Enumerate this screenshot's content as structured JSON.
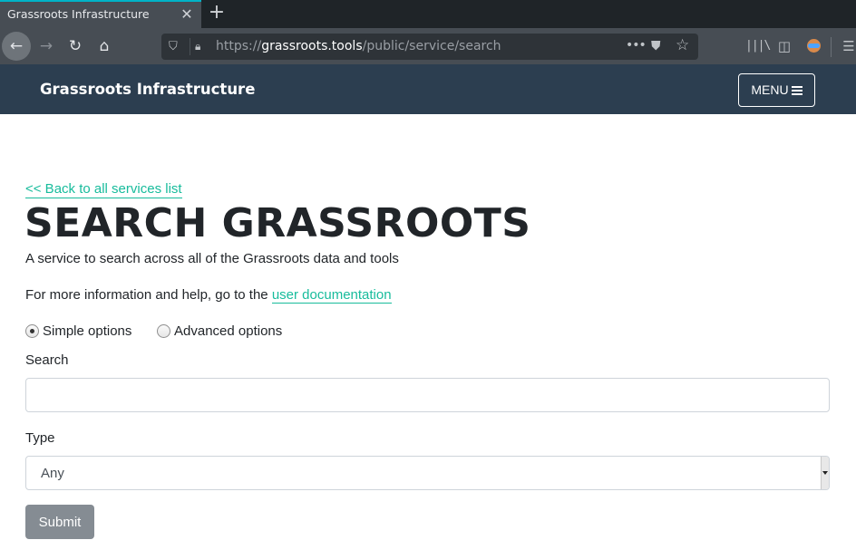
{
  "browser": {
    "tab": {
      "title": "Grassroots Infrastructure",
      "close_icon": "close-icon"
    },
    "new_tab_icon": "plus-icon",
    "nav": {
      "back_icon": "arrow-left-icon",
      "forward_icon": "arrow-right-icon",
      "reload_icon": "reload-icon",
      "home_icon": "home-icon"
    },
    "url": {
      "scheme": "https://",
      "host": "grassroots.tools",
      "path": "/public/service/search"
    },
    "toolbar_icons": [
      "shield-icon",
      "lock-icon",
      "more-icon",
      "pocket-icon",
      "star-icon",
      "library-icon",
      "sidebar-icon",
      "account-avatar-icon",
      "hamburger-icon"
    ]
  },
  "header": {
    "site_title": "Grassroots Infrastructure",
    "menu_label": "MENU"
  },
  "page": {
    "back_link": "<< Back to all services list",
    "title": "SEARCH GRASSROOTS",
    "description": "A service to search across all of the Grassroots data and tools",
    "more_info_prefix": "For more information and help, go to the ",
    "doc_link": "user documentation",
    "colors": {
      "accent": "#18bc9c",
      "header_bg": "#2c3e50",
      "button_bg": "#858c93"
    }
  },
  "form": {
    "options": [
      {
        "label": "Simple options",
        "checked": true
      },
      {
        "label": "Advanced options",
        "checked": false
      }
    ],
    "search": {
      "label": "Search",
      "value": "",
      "placeholder": ""
    },
    "type": {
      "label": "Type",
      "selected": "Any"
    },
    "submit_label": "Submit"
  }
}
